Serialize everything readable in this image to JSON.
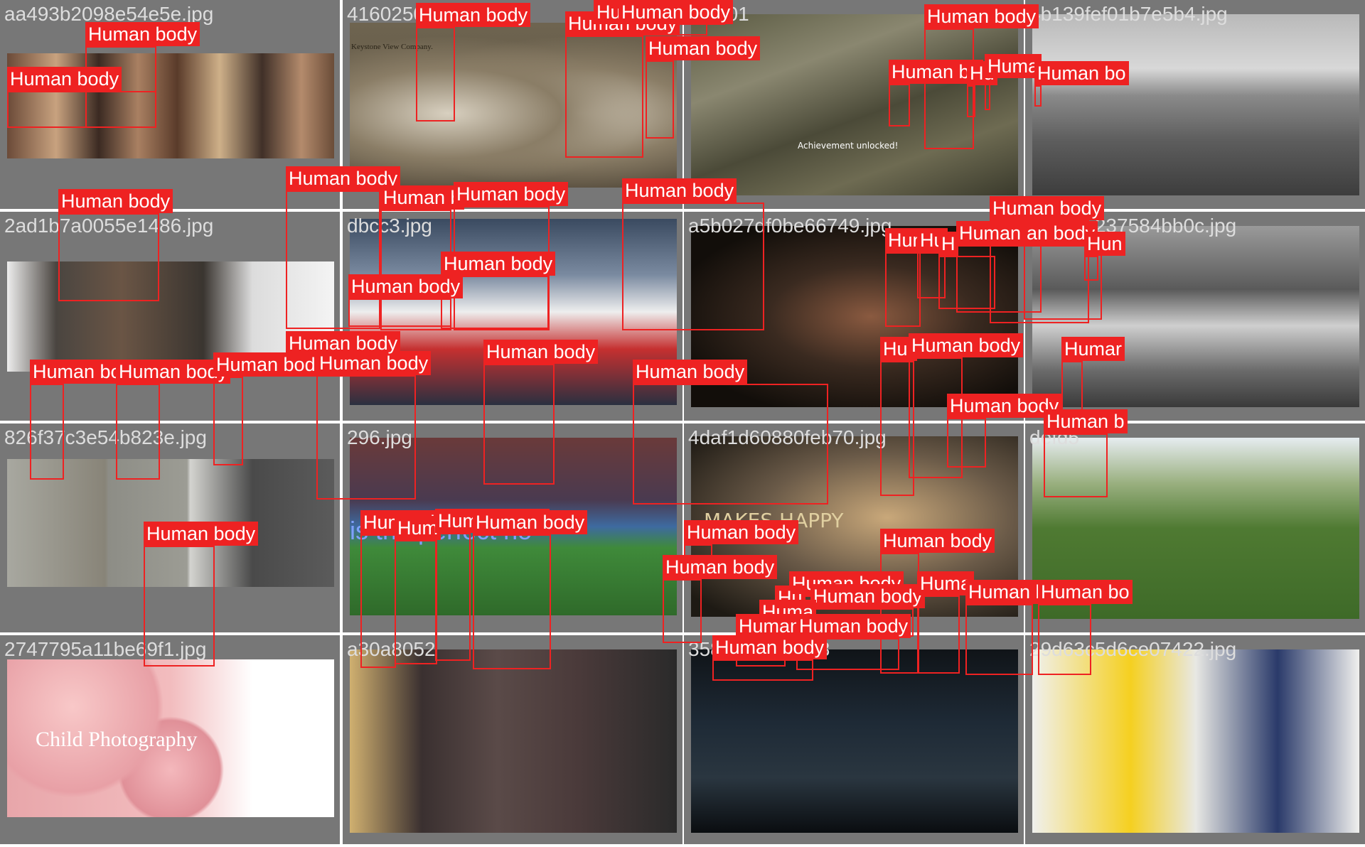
{
  "colors": {
    "box": "#ee2222",
    "tile_bg": "#777777",
    "filename_text": "#dddddd"
  },
  "tiles": [
    {
      "filename": "aa493b2098e54e5e.jpg",
      "theme": "group-selfie",
      "labels": [
        "Human body",
        "Human body"
      ]
    },
    {
      "filename": "4160250c08b5e4",
      "theme": "sepia-stereo-card",
      "labels": [
        "Human body"
      ]
    },
    {
      "filename": "61fe01",
      "theme": "video-game",
      "labels": [
        "Human body",
        "Human body",
        "Human body",
        "Human body"
      ]
    },
    {
      "filename": "4b139fef01b7e5b4.jpg",
      "theme": "grayscale-harbor",
      "labels": [
        "Human body",
        "Human bo",
        "Hu",
        "Huma",
        "Human bo"
      ]
    },
    {
      "filename": "2ad1b7a0055e1486.jpg",
      "theme": "headset-man",
      "labels": [
        "Human body"
      ]
    },
    {
      "filename": "dbcc3.jpg",
      "theme": "folk-costumes",
      "labels": [
        "Human body",
        "Human b",
        "Human body",
        "Human body",
        "Human body"
      ]
    },
    {
      "filename": "a5b027df0be66749.jpg",
      "theme": "dark-indoor-eating",
      "labels": [
        "Human body"
      ]
    },
    {
      "filename": "37089c237584bb0c.jpg",
      "theme": "grayscale-street",
      "labels": [
        "Human body",
        "Hun",
        "Hu",
        "H",
        "Human body",
        "an body",
        "Hun"
      ]
    },
    {
      "filename": "826f37c3e54b823e.jpg",
      "theme": "dress-collage",
      "labels": [
        "Human bo",
        "Human body",
        "Human bod"
      ]
    },
    {
      "filename": "296.jpg",
      "theme": "football-match",
      "labels": [
        "Human body",
        "Human body",
        "Human body"
      ]
    },
    {
      "filename": "4daf1d60880feb70.jpg",
      "theme": "man-with-bat",
      "labels": [
        "Human body"
      ]
    },
    {
      "filename": "defd5",
      "theme": "park-picnic",
      "labels": [
        "Hur",
        "Human body",
        "Humar",
        "Human body",
        "Human b"
      ]
    },
    {
      "filename": "2747795a11be69f1.jpg",
      "theme": "child-photography",
      "labels": [
        "Human body"
      ]
    },
    {
      "filename": "a30a8052",
      "theme": "lingerie-figures",
      "labels": [
        "Human bo",
        "Hum",
        "Human body",
        "Human body"
      ]
    },
    {
      "filename": "35866010c20c8",
      "theme": "concert-stage",
      "labels": [
        "Human body",
        "Human body",
        "Human body",
        "Hu",
        "Human body",
        "Huma",
        "Human",
        "Human body",
        "Human body"
      ]
    },
    {
      "filename": "29d63c5d6ce07422.jpg",
      "theme": "office-team",
      "labels": [
        "Human body",
        "Huma",
        "Human bo",
        "Human bo"
      ]
    }
  ],
  "photo_texts": {
    "t13": "Child Photography",
    "t10": "is the perfect ho",
    "t11": "MAKES HAPPY",
    "t3": "Achievement unlocked!",
    "t2": "Keystone View Company."
  }
}
